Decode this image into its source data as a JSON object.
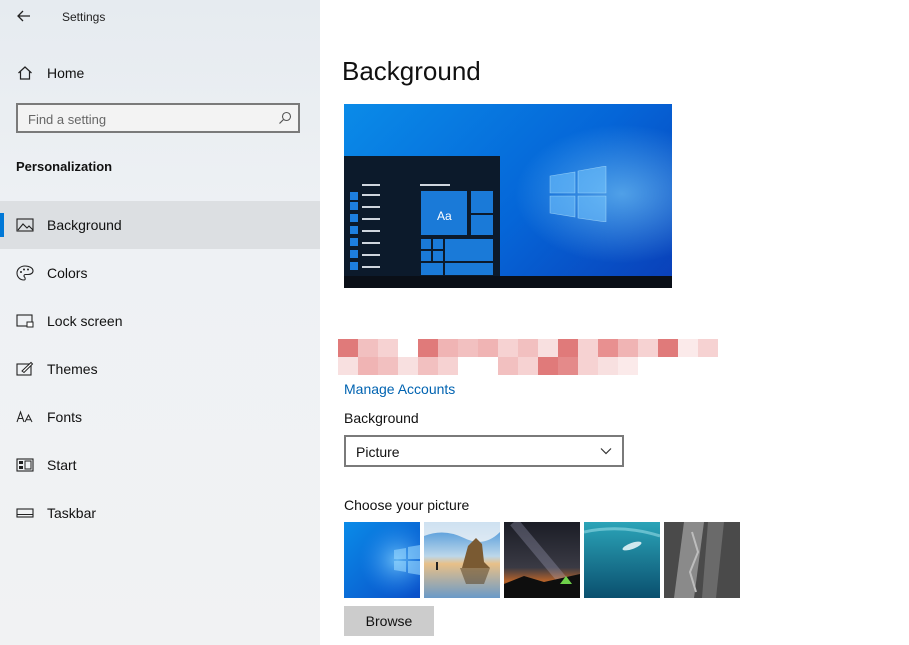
{
  "window": {
    "title": "Settings"
  },
  "sidebar": {
    "home_label": "Home",
    "search_placeholder": "Find a setting",
    "section_heading": "Personalization",
    "items": [
      {
        "label": "Background",
        "icon": "picture-icon",
        "active": true
      },
      {
        "label": "Colors",
        "icon": "palette-icon"
      },
      {
        "label": "Lock screen",
        "icon": "lock-screen-icon"
      },
      {
        "label": "Themes",
        "icon": "themes-icon"
      },
      {
        "label": "Fonts",
        "icon": "fonts-icon"
      },
      {
        "label": "Start",
        "icon": "start-icon"
      },
      {
        "label": "Taskbar",
        "icon": "taskbar-icon"
      }
    ]
  },
  "main": {
    "title": "Background",
    "preview_tile_text": "Aa",
    "manage_accounts_link": "Manage Accounts",
    "background_label": "Background",
    "background_dropdown_value": "Picture",
    "choose_picture_label": "Choose your picture",
    "pictures": [
      "windows-blue-wallpaper",
      "beach-rock-wallpaper",
      "night-sky-tent-wallpaper",
      "underwater-swimmer-wallpaper",
      "rock-cliff-wallpaper"
    ],
    "browse_button": "Browse"
  },
  "colors": {
    "accent": "#0078d7",
    "link": "#0063b1",
    "sidebar_bg": "#eef1f4",
    "redacted": "#e07a7a"
  }
}
